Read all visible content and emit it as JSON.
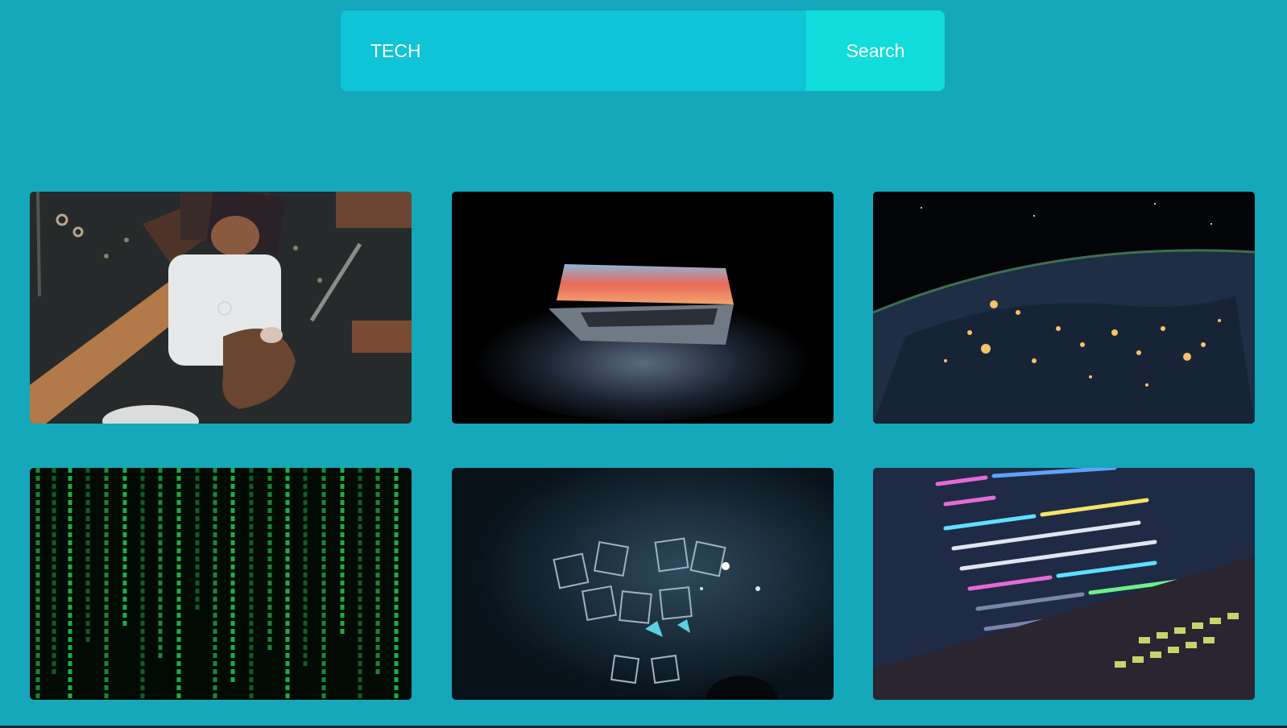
{
  "search": {
    "value": "TECH",
    "button_label": "Search"
  },
  "gallery": {
    "images": [
      {
        "subject": "card-payment-reader"
      },
      {
        "subject": "laptop-in-dark"
      },
      {
        "subject": "earth-night-lights"
      },
      {
        "subject": "matrix-code-rain"
      },
      {
        "subject": "glowing-cubes-stage"
      },
      {
        "subject": "code-editor-laptop"
      }
    ]
  },
  "colors": {
    "background": "#14a8ba",
    "input_bg": "#0fc4d6",
    "button_bg": "#11dcdc"
  }
}
